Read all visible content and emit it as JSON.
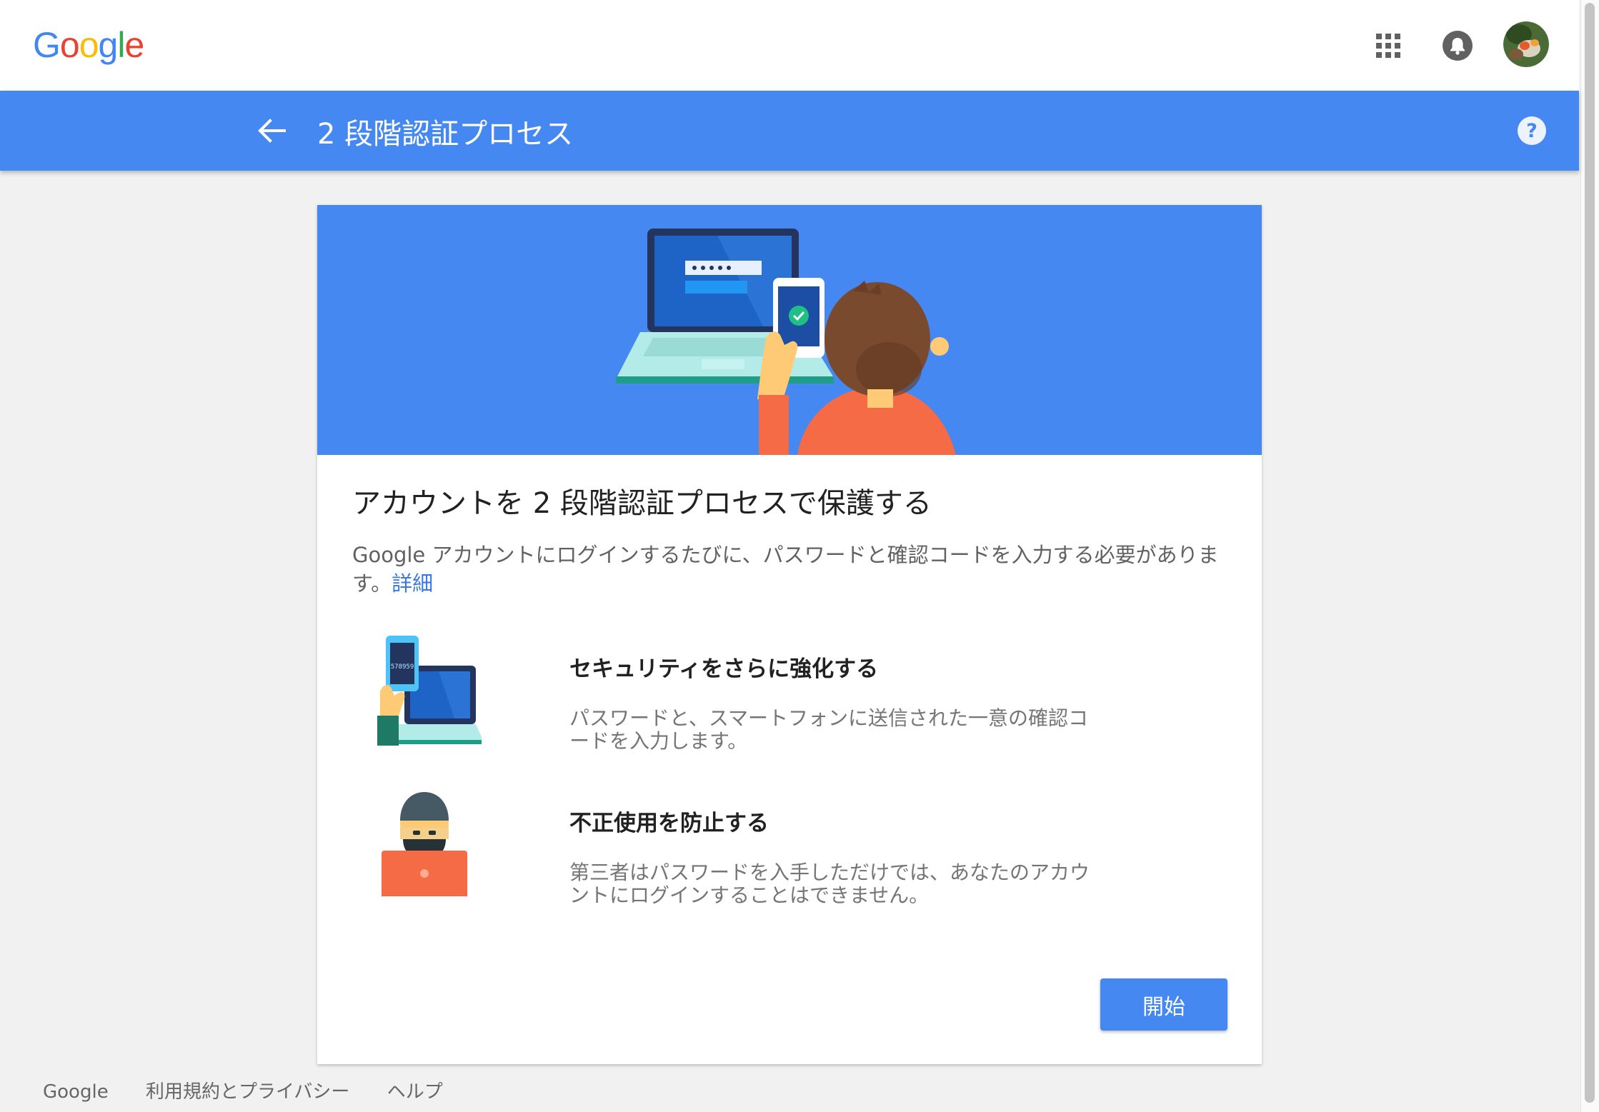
{
  "header": {
    "logo": "Google",
    "icons": {
      "apps": "apps-grid-icon",
      "notifications": "bell-icon",
      "avatar": "user-avatar"
    }
  },
  "title_bar": {
    "back_icon": "arrow-back-icon",
    "title": "2 段階認証プロセス",
    "help_icon": "help-circle-icon",
    "color": "#4688f1"
  },
  "card": {
    "heading": "アカウントを 2 段階認証プロセスで保護する",
    "description": "Google アカウントにログインするたびに、パスワードと確認コードを入力する必要があります。",
    "learn_more": "詳細",
    "features": [
      {
        "title": "セキュリティをさらに強化する",
        "text": "パスワードと、スマートフォンに送信された一意の確認コードを入力します。",
        "phone_code": "578959"
      },
      {
        "title": "不正使用を防止する",
        "text": "第三者はパスワードを入手しただけでは、あなたのアカウントにログインすることはできません。"
      }
    ],
    "start_button": "開始"
  },
  "footer": {
    "links": [
      "Google",
      "利用規約とプライバシー",
      "ヘルプ"
    ]
  }
}
